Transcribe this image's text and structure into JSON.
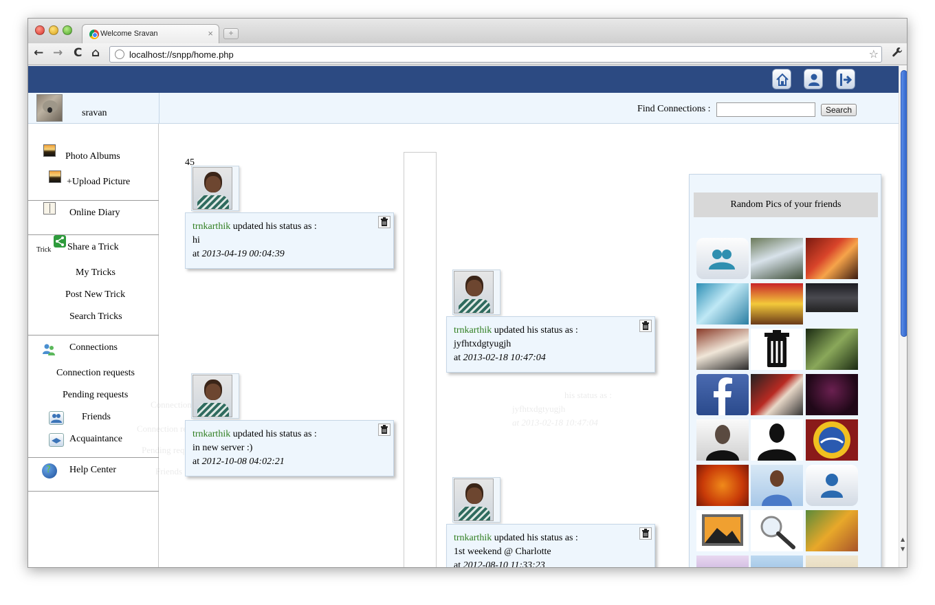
{
  "browser": {
    "tab_title": "Welcome Sravan",
    "tab_close": "×",
    "new_tab": "+",
    "url": "localhost://snpp/home.php",
    "back_icon": "←",
    "forward_icon": "→",
    "reload_icon": "C",
    "home_icon": "⌂",
    "star_icon": "☆",
    "wrench_icon": "🔧"
  },
  "topbar": {
    "icons": [
      "home-icon",
      "profile-icon",
      "logout-icon"
    ],
    "color": "#2c4a82"
  },
  "user": {
    "name": "sravan"
  },
  "search": {
    "label": "Find Connections :",
    "value": "",
    "button": "Search"
  },
  "sidebar": {
    "photo_albums": "Photo Albums",
    "upload_picture": "+Upload Picture",
    "online_diary": "Online Diary",
    "trick_tag": "Trick",
    "share_trick": "Share a Trick",
    "my_tricks": "My Tricks",
    "post_new_trick": "Post New Trick",
    "search_tricks": "Search Tricks",
    "connections": "Connections",
    "connection_requests": "Connection requests",
    "pending_requests": "Pending requests",
    "friends": "Friends",
    "acquaintance": "Acquaintance",
    "help_center": "Help Center"
  },
  "timeline": {
    "count": "45",
    "posts": [
      {
        "user": "trnkarthik",
        "action": " updated his status as :",
        "status": "hi",
        "at": "at ",
        "time": "2013-04-19 00:04:39"
      },
      {
        "user": "trnkarthik",
        "action": " updated his status as :",
        "status": "jyfhtxdgtyugjh",
        "at": "at ",
        "time": "2013-02-18 10:47:04"
      },
      {
        "user": "trnkarthik",
        "action": " updated his status as :",
        "status": "in new server :)",
        "at": "at ",
        "time": "2012-10-08 04:02:21"
      },
      {
        "user": "trnkarthik",
        "action": " updated his status as :",
        "status": "1st weekend @ Charlotte",
        "at": "at ",
        "time": "2012-08-10 11:33:23"
      }
    ]
  },
  "ghost_text": {
    "connections": "Connections",
    "connection_requests": "Connection re",
    "pending_requests": "Pending reque",
    "friends": "Friends",
    "status": "his status as :",
    "status_value": "jyfhtxdgtyugjh",
    "status_time": "at 2013-02-18 10:47:04"
  },
  "friends_panel": {
    "title": "Random Pics of your friends",
    "thumbnails": [
      "group-icon",
      "waterfall-photo",
      "spiderman-photo",
      "water-photo",
      "chip-dale-photo",
      "runner-photo",
      "spiderman-wall-photo",
      "trash-icon",
      "forest-photo",
      "facebook-logo",
      "spiderman-city-photo",
      "fireworks-photo",
      "steve-jobs-photo",
      "silhouette-photo",
      "university-seal",
      "orange-flower-photo",
      "man-portrait-photo",
      "user-icon",
      "picture-icon",
      "magnifier-icon",
      "autumn-photo",
      "purple-photo",
      "blue-doc-photo",
      "sand-photo"
    ]
  }
}
